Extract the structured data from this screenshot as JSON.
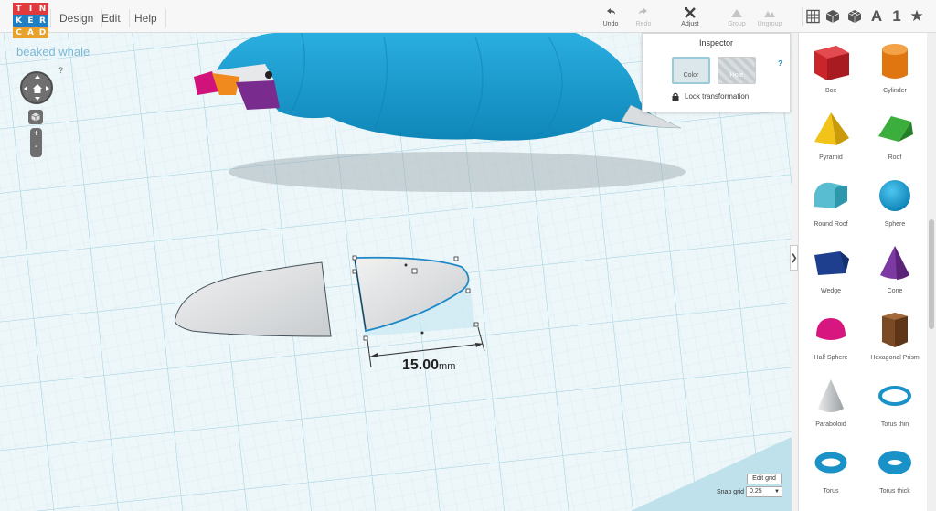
{
  "logo": {
    "letters": [
      "T",
      "I",
      "N",
      "K",
      "E",
      "R",
      "C",
      "A",
      "D"
    ],
    "colors": [
      "#e03a3e",
      "#e03a3e",
      "#e03a3e",
      "#1e7fc4",
      "#1e7fc4",
      "#1e7fc4",
      "#e8a12b",
      "#e8a12b",
      "#e8a12b"
    ]
  },
  "menu": {
    "design": "Design",
    "edit": "Edit",
    "help": "Help"
  },
  "toolbar": {
    "undo": "Undo",
    "redo": "Redo",
    "adjust": "Adjust",
    "group": "Group",
    "ungroup": "Ungroup",
    "view_icons": [
      "grid-view-icon",
      "box-view-icon",
      "cube-outline-icon"
    ],
    "letter_a": "A",
    "number_1": "1",
    "star": "★"
  },
  "canvas": {
    "design_title": "beaked whale",
    "help_mark": "?",
    "dimension_value": "15.00",
    "dimension_unit": "mm",
    "zoom_plus": "+",
    "zoom_minus": "-"
  },
  "inspector": {
    "title": "Inspector",
    "color_label": "Color",
    "hole_label": "Hole",
    "help": "?",
    "lock_label": "Lock transformation"
  },
  "grid": {
    "edit_label": "Edit grid",
    "snap_label": "Snap grid",
    "snap_value": "0.25"
  },
  "panel": {
    "collapse": "❯",
    "shapes": [
      {
        "name": "Box",
        "icon": "box-icon"
      },
      {
        "name": "Cylinder",
        "icon": "cylinder-icon"
      },
      {
        "name": "Pyramid",
        "icon": "pyramid-icon"
      },
      {
        "name": "Roof",
        "icon": "roof-icon"
      },
      {
        "name": "Round Roof",
        "icon": "round-roof-icon"
      },
      {
        "name": "Sphere",
        "icon": "sphere-icon"
      },
      {
        "name": "Wedge",
        "icon": "wedge-icon"
      },
      {
        "name": "Cone",
        "icon": "cone-icon"
      },
      {
        "name": "Half Sphere",
        "icon": "half-sphere-icon"
      },
      {
        "name": "Hexagonal Prism",
        "icon": "hexagonal-prism-icon"
      },
      {
        "name": "Paraboloid",
        "icon": "paraboloid-icon"
      },
      {
        "name": "Torus thin",
        "icon": "torus-thin-icon"
      },
      {
        "name": "Torus",
        "icon": "torus-icon"
      },
      {
        "name": "Torus thick",
        "icon": "torus-thick-icon"
      }
    ]
  },
  "colors": {
    "accent": "#1e88c7",
    "whale_blue": "#1a9bd0",
    "grid_bg": "#e9f3f6",
    "grid_line": "#b9dde8"
  }
}
